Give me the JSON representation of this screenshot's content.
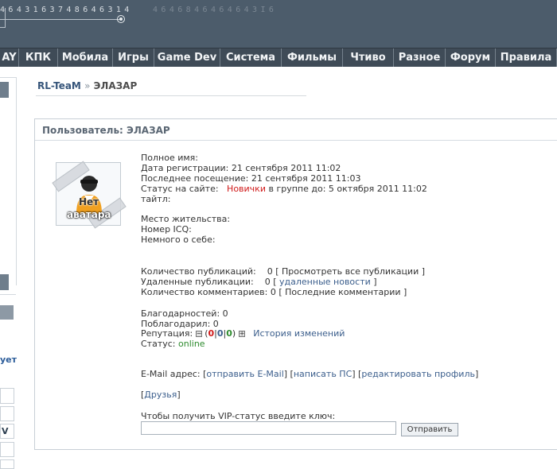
{
  "header": {
    "digits": "4643163748646314",
    "digits_faint": "4646846464643I6"
  },
  "nav": [
    {
      "label": "AY",
      "width": 24
    },
    {
      "label": "КПК",
      "width": 49
    },
    {
      "label": "Мобила",
      "width": 69
    },
    {
      "label": "Игры",
      "width": 52
    },
    {
      "label": "Game Dev",
      "width": 83
    },
    {
      "label": "Система",
      "width": 77
    },
    {
      "label": "Фильмы",
      "width": 77
    },
    {
      "label": "Чтиво",
      "width": 64
    },
    {
      "label": "Разное",
      "width": 65
    },
    {
      "label": "Форум",
      "width": 63
    },
    {
      "label": "Правила",
      "width": 77
    }
  ],
  "sidebar": {
    "partial_text": "ует",
    "partial_button": "V"
  },
  "breadcrumb": {
    "home": "RL-TeaM",
    "separator": "»",
    "current": "ЭЛАЗАР"
  },
  "panel": {
    "title": "Пользователь: ЭЛАЗАР"
  },
  "avatar": {
    "line1": "Нет",
    "line2": "аватара"
  },
  "profile": {
    "full_name": "Полное имя:",
    "reg_date": "Дата регистрации: 21 сентября 2011 11:02",
    "last_visit": "Последнее посещение: 21 сентября 2011 11:03",
    "status_label": "Статус на сайте:",
    "group": "Новички",
    "group_until": "в группе до: 5 октября 2011 11:02",
    "title": "тайтл:",
    "residence": "Место жительства:",
    "icq": "Номер ICQ:",
    "about": "Немного о себе:",
    "pubs_label": "Количество публикаций:",
    "pubs_count": "0",
    "pubs_link": "Просмотреть все публикации",
    "deleted_label": "Удаленные публикации:",
    "deleted_count": "0",
    "deleted_link": "удаленные новости",
    "comments_label": "Количество комментариев:",
    "comments_count": "0",
    "comments_link": "Последние комментарии",
    "thanks": "Благодарностей: 0",
    "thanked": "Поблагодарил: 0",
    "rep_label": "Репутация:",
    "rep_neg": "0",
    "rep_zero": "0",
    "rep_pos": "0",
    "history_link": "История изменений",
    "status2_label": "Статус:",
    "status2_value": "online",
    "email_label": "E-Mail адрес:",
    "email_link": "отправить E-Mail",
    "pm_link": "написать ПС",
    "edit_link": "редактировать профиль",
    "friends_link": "Друзья",
    "vip_label": "Чтобы получить VIP-статус введите ключ:",
    "send_button": "Отправить"
  },
  "colors": {
    "header": "#4c5c6b",
    "nav": "#3f4b57",
    "link": "#3b5e8c",
    "group": "#d01919",
    "online": "#2e8b2e"
  }
}
